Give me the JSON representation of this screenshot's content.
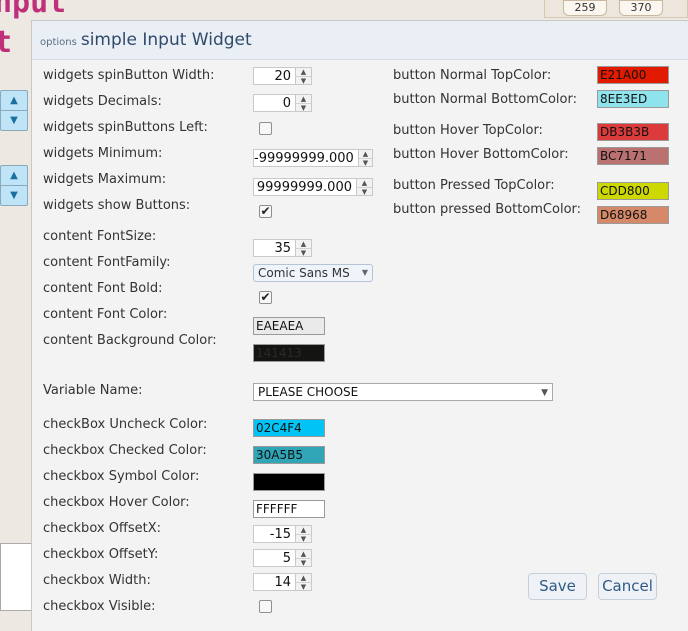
{
  "background": {
    "title_line1": "nput",
    "title_line2": "t",
    "tabs": [
      "259",
      "370"
    ]
  },
  "dialog": {
    "title_prefix": "options",
    "title": "simple Input Widget"
  },
  "left_fields": [
    {
      "label": "widgets spinButton Width:",
      "type": "spin",
      "value": "20"
    },
    {
      "label": "widgets Decimals:",
      "type": "spin",
      "value": "0"
    },
    {
      "label": "widgets spinButtons Left:",
      "type": "checkbox",
      "checked": false
    },
    {
      "label": "widgets Minimum:",
      "type": "spin",
      "value": "-99999999.000"
    },
    {
      "label": "widgets Maximum:",
      "type": "spin",
      "value": "99999999.000"
    },
    {
      "label": "widgets show Buttons:",
      "type": "checkbox",
      "checked": true
    },
    {
      "label": "content FontSize:",
      "type": "spin",
      "value": "35"
    },
    {
      "label": "content FontFamily:",
      "type": "select",
      "value": "Comic Sans MS"
    },
    {
      "label": "content Font Bold:",
      "type": "checkbox",
      "checked": true
    },
    {
      "label": "content Font Color:",
      "type": "color",
      "value": "EAEAEA",
      "color": "#EAEAEA"
    },
    {
      "label": "content Background Color:",
      "type": "color",
      "value": "141413",
      "color": "#141413"
    },
    {
      "label": "Variable Name:",
      "type": "dropdown",
      "value": "PLEASE CHOOSE"
    },
    {
      "label": "checkBox Uncheck Color:",
      "type": "color",
      "value": "02C4F4",
      "color": "#02C4F4"
    },
    {
      "label": "checkbox Checked Color:",
      "type": "color",
      "value": "30A5B5",
      "color": "#30A5B5"
    },
    {
      "label": "checkbox Symbol Color:",
      "type": "color",
      "value": "",
      "color": "#000000"
    },
    {
      "label": "checkbox Hover Color:",
      "type": "color",
      "value": "FFFFFF",
      "color": "#FFFFFF"
    },
    {
      "label": "checkbox OffsetX:",
      "type": "spin",
      "value": "-15"
    },
    {
      "label": "checkbox OffsetY:",
      "type": "spin",
      "value": "5"
    },
    {
      "label": "checkbox Width:",
      "type": "spin",
      "value": "14"
    },
    {
      "label": "checkbox Visible:",
      "type": "checkbox",
      "checked": false
    }
  ],
  "right_fields": [
    {
      "label": "button Normal TopColor:",
      "value": "E21A00",
      "color": "#E21A00"
    },
    {
      "label": "button Normal BottomColor:",
      "value": "8EE3ED",
      "color": "#8EE3ED"
    },
    {
      "label": "button Hover TopColor:",
      "value": "DB3B3B",
      "color": "#DB3B3B"
    },
    {
      "label": "button Hover BottomColor:",
      "value": "BC7171",
      "color": "#BC7171"
    },
    {
      "label": "button Pressed TopColor:",
      "value": "CDD800",
      "color": "#CDD800"
    },
    {
      "label": "button pressed BottomColor:",
      "value": "D68968",
      "color": "#D68968"
    }
  ],
  "buttons": {
    "save": "Save",
    "cancel": "Cancel"
  }
}
